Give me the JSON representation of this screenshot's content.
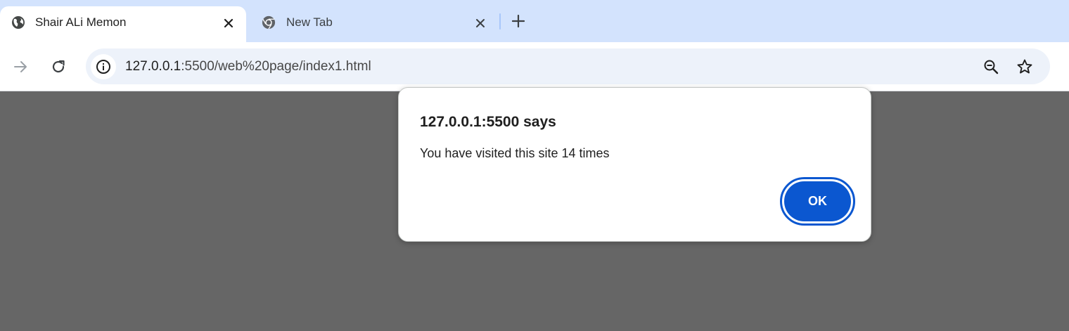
{
  "tabs": [
    {
      "title": "Shair ALi Memon",
      "icon": "globe-icon",
      "active": true
    },
    {
      "title": "New Tab",
      "icon": "chrome-icon",
      "active": false
    }
  ],
  "toolbar": {
    "url_host": "127.0.0.1",
    "url_path": ":5500/web%20page/index1.html"
  },
  "dialog": {
    "title": "127.0.0.1:5500 says",
    "message": "You have visited this site 14 times",
    "ok_label": "OK"
  },
  "colors": {
    "tabstrip": "#d3e3fd",
    "omnibox": "#edf2fa",
    "accent": "#0b57d0",
    "page_overlay": "#666666"
  }
}
